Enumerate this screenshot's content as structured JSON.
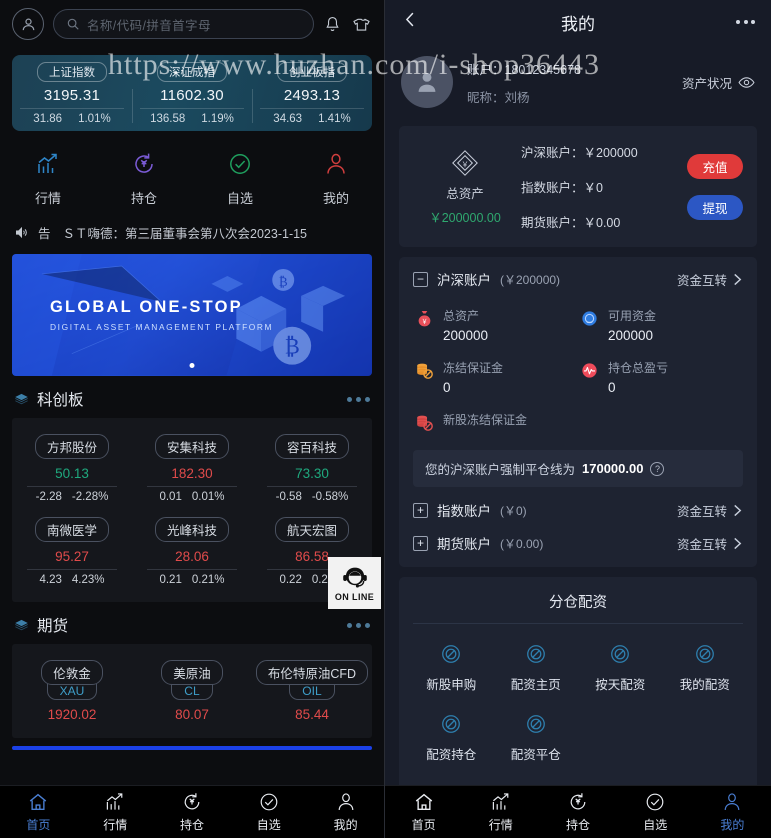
{
  "watermark": {
    "text": "https://www.huzhan.com/i-shop36443"
  },
  "left": {
    "topbar": {
      "avatar_icon": "user-icon",
      "search_icon": "search-icon",
      "search_placeholder": "名称/代码/拼音首字母",
      "search_value": "",
      "bell_icon": "bell-icon",
      "shirt_icon": "shirt-icon"
    },
    "indices": [
      {
        "name": "上证指数",
        "value": "3195.31",
        "change": "31.86",
        "percent": "1.01%"
      },
      {
        "name": "深证成指",
        "value": "11602.30",
        "change": "136.58",
        "percent": "1.19%"
      },
      {
        "name": "创业板指",
        "value": "2493.13",
        "change": "34.63",
        "percent": "1.41%"
      }
    ],
    "quick_nav": [
      {
        "label": "行情",
        "icon": "chart-up-icon",
        "color": "#2a7fc4"
      },
      {
        "label": "持仓",
        "icon": "yuan-refresh-icon",
        "color": "#7b5bd6"
      },
      {
        "label": "自选",
        "icon": "check-circle-icon",
        "color": "#1f9f5e"
      },
      {
        "label": "我的",
        "icon": "person-icon",
        "color": "#d13e3e"
      }
    ],
    "notice": {
      "speaker_icon": "speaker-icon",
      "tag": "告",
      "text": "ＳＴ嗨德：第三届董事会第八次会2023-1-15"
    },
    "banner": {
      "title": "GLOBAL ONE-STOP",
      "subtitle": "DIGITAL ASSET MANAGEMENT PLATFORM"
    },
    "sections": [
      {
        "title": "科创板",
        "icon": "layers-icon",
        "more_icon": "more-dots-icon",
        "type": "stock",
        "items": [
          {
            "name": "方邦股份",
            "price": "50.13",
            "change": "-2.28",
            "percent": "-2.28%",
            "dir": "down"
          },
          {
            "name": "安集科技",
            "price": "182.30",
            "change": "0.01",
            "percent": "0.01%",
            "dir": "up"
          },
          {
            "name": "容百科技",
            "price": "73.30",
            "change": "-0.58",
            "percent": "-0.58%",
            "dir": "down"
          },
          {
            "name": "南微医学",
            "price": "95.27",
            "change": "4.23",
            "percent": "4.23%",
            "dir": "up"
          },
          {
            "name": "光峰科技",
            "price": "28.06",
            "change": "0.21",
            "percent": "0.21%",
            "dir": "up"
          },
          {
            "name": "航天宏图",
            "price": "86.58",
            "change": "0.22",
            "percent": "0.22%",
            "dir": "up"
          }
        ]
      },
      {
        "title": "期货",
        "icon": "layers-icon",
        "more_icon": "more-dots-icon",
        "type": "futures",
        "items": [
          {
            "name": "伦敦金",
            "code": "XAU",
            "price": "1920.02",
            "dir": "up"
          },
          {
            "name": "美原油",
            "code": "CL",
            "price": "80.07",
            "dir": "up"
          },
          {
            "name": "布伦特原油CFD",
            "code": "OIL",
            "price": "85.44",
            "dir": "up"
          }
        ]
      }
    ],
    "online_badge": {
      "icon": "headset-icon",
      "label": "ON LINE"
    },
    "tabbar": {
      "items": [
        {
          "label": "首页",
          "icon": "home-icon",
          "active": true
        },
        {
          "label": "行情",
          "icon": "chart-up-icon",
          "active": false
        },
        {
          "label": "持仓",
          "icon": "yuan-refresh-icon",
          "active": false
        },
        {
          "label": "自选",
          "icon": "check-circle-icon",
          "active": false
        },
        {
          "label": "我的",
          "icon": "person-icon",
          "active": false
        }
      ]
    }
  },
  "right": {
    "topbar": {
      "back_icon": "chevron-left-icon",
      "title": "我的",
      "more_icon": "more-dots-icon"
    },
    "profile": {
      "avatar_icon": "user-icon",
      "account_label": "账户：",
      "account_value": "18012345678",
      "nickname_label": "昵称：",
      "nickname_value": "刘杨",
      "asset_status_label": "资产状况",
      "eye_icon": "eye-icon"
    },
    "assets": {
      "diamond_icon": "diamond-coin-icon",
      "total_label": "总资产",
      "total_value": "￥200000.00",
      "rows": [
        "沪深账户：￥200000",
        "指数账户：￥0",
        "期货账户：￥0.00"
      ],
      "recharge_label": "充值",
      "withdraw_label": "提现",
      "recharge_color": "#e03a3a",
      "withdraw_color": "#2c57c4"
    },
    "hs_account": {
      "toggle_icon": "minus-box-icon",
      "name": "沪深账户",
      "sub": "(￥200000)",
      "transfer_label": "资金互转",
      "chevron_icon": "chevron-right-icon",
      "stats": [
        {
          "label": "总资产",
          "value": "200000",
          "icon": "money-bag-icon",
          "color": "#e8505a"
        },
        {
          "label": "可用资金",
          "value": "200000",
          "icon": "coin-blue-icon",
          "color": "#2f7ce0"
        },
        {
          "label": "冻结保证金",
          "value": "0",
          "icon": "coins-lock-icon",
          "color": "#f0a13a"
        },
        {
          "label": "持仓总盈亏",
          "value": "0",
          "icon": "pulse-icon",
          "color": "#ef4b5b"
        },
        {
          "label": "新股冻结保证金",
          "value": "",
          "icon": "coins-block-icon",
          "color": "#e25050"
        }
      ],
      "warning": {
        "prefix": "您的沪深账户强制平仓线为",
        "value": "170000.00",
        "help_icon": "question-icon"
      }
    },
    "sub_accounts": [
      {
        "toggle_icon": "plus-box-icon",
        "name": "指数账户",
        "sub": "(￥0)",
        "transfer_label": "资金互转",
        "chevron_icon": "chevron-right-icon"
      },
      {
        "toggle_icon": "plus-box-icon",
        "name": "期货账户",
        "sub": "(￥0.00)",
        "transfer_label": "资金互转",
        "chevron_icon": "chevron-right-icon"
      }
    ],
    "allocation": {
      "title": "分仓配资",
      "items": [
        {
          "label": "新股申购",
          "icon": "spiral-icon"
        },
        {
          "label": "配资主页",
          "icon": "spiral-icon"
        },
        {
          "label": "按天配资",
          "icon": "spiral-icon"
        },
        {
          "label": "我的配资",
          "icon": "spiral-icon"
        },
        {
          "label": "配资持仓",
          "icon": "spiral-icon"
        },
        {
          "label": "配资平仓",
          "icon": "spiral-icon"
        }
      ]
    },
    "tabbar": {
      "items": [
        {
          "label": "首页",
          "icon": "home-icon",
          "active": false
        },
        {
          "label": "行情",
          "icon": "chart-up-icon",
          "active": false
        },
        {
          "label": "持仓",
          "icon": "yuan-refresh-icon",
          "active": false
        },
        {
          "label": "自选",
          "icon": "check-circle-icon",
          "active": false
        },
        {
          "label": "我的",
          "icon": "person-icon",
          "active": true
        }
      ]
    }
  }
}
